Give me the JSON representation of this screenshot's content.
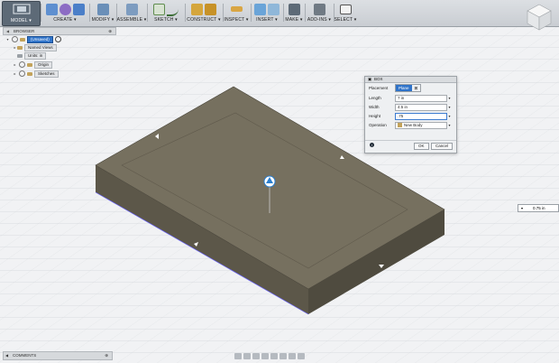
{
  "toolbar": {
    "mode_label": "MODEL ▾",
    "groups": [
      {
        "label": "CREATE ▾"
      },
      {
        "label": "MODIFY ▾"
      },
      {
        "label": "ASSEMBLE ▾"
      },
      {
        "label": "SKETCH ▾"
      },
      {
        "label": "CONSTRUCT ▾"
      },
      {
        "label": "INSPECT ▾"
      },
      {
        "label": "INSERT ▾"
      },
      {
        "label": "MAKE ▾"
      },
      {
        "label": "ADD-INS ▾"
      },
      {
        "label": "SELECT ▾"
      }
    ]
  },
  "browser": {
    "title": "BROWSER",
    "items": [
      {
        "label": "(Unsaved)"
      },
      {
        "label": "Named Views"
      },
      {
        "label": "Units: in"
      },
      {
        "label": "Origin"
      },
      {
        "label": "Sketches"
      }
    ]
  },
  "dialog": {
    "title": "BOX",
    "placement": {
      "label": "Placement",
      "option1": "Plane",
      "option2": "⊠"
    },
    "length": {
      "label": "Length",
      "value": "7 in"
    },
    "width": {
      "label": "Width",
      "value": "4.5 in"
    },
    "height": {
      "label": "Height",
      "value": ".75"
    },
    "operation": {
      "label": "Operation",
      "value": "New Body"
    },
    "ok_label": "OK",
    "cancel_label": "Cancel"
  },
  "measure": {
    "value": "0.75 in"
  },
  "comments": {
    "title": "COMMENTS"
  },
  "colors": {
    "accent": "#2f73c9",
    "body_top": "#76705f",
    "body_side": "#5c5749"
  }
}
